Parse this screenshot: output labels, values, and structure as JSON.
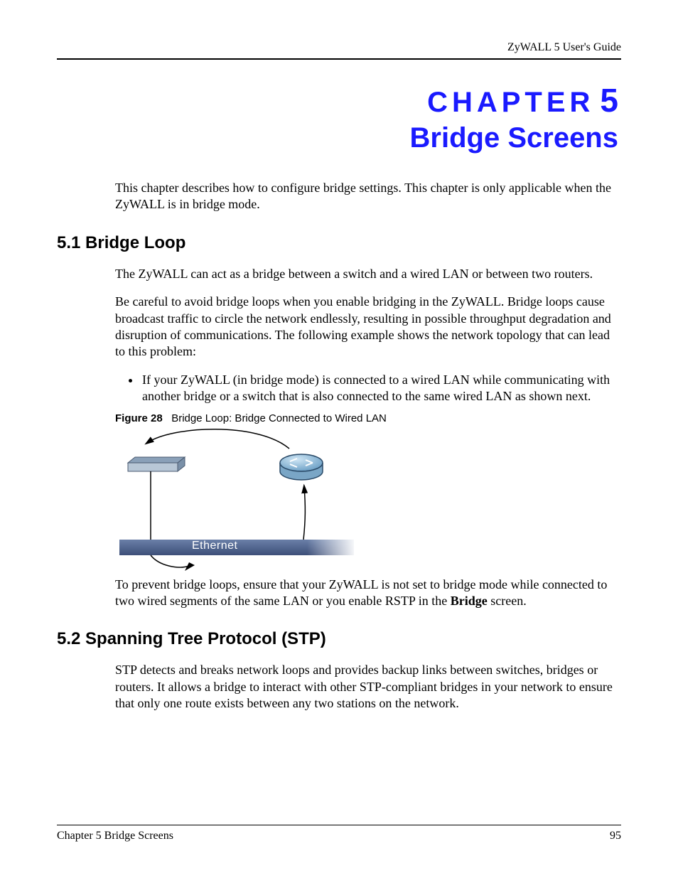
{
  "header": {
    "running_head": "ZyWALL 5 User's Guide"
  },
  "chapter": {
    "label_word": "CHAPTER",
    "number": "5",
    "title": "Bridge Screens",
    "intro": "This chapter describes how to configure bridge settings. This chapter is only applicable when the ZyWALL is in bridge mode."
  },
  "section51": {
    "heading": "5.1  Bridge Loop",
    "p1": "The ZyWALL can act as a bridge between a switch and a wired LAN or between two routers.",
    "p2": "Be careful to avoid bridge loops when you enable bridging in the ZyWALL. Bridge loops cause broadcast traffic to circle the network endlessly, resulting in possible throughput degradation and disruption of communications. The following example shows the network topology that can lead to this problem:",
    "bullet1": "If your ZyWALL (in bridge mode) is connected to a wired LAN while communicating with another bridge or a switch that is also connected to the same wired LAN as shown next.",
    "fig_label": "Figure 28",
    "fig_title": "Bridge Loop: Bridge Connected to Wired LAN",
    "ethernet_label": "Ethernet",
    "p3_a": "To prevent bridge loops, ensure that your ZyWALL is not set to bridge mode while connected to two wired segments of the same LAN or you enable RSTP in the ",
    "p3_bold": "Bridge",
    "p3_b": " screen."
  },
  "section52": {
    "heading": "5.2  Spanning Tree Protocol (STP)",
    "p1": "STP detects and breaks network loops and provides backup links between switches, bridges or routers. It allows a bridge to interact with other STP-compliant bridges in your network to ensure that only one route exists between any two stations on the network."
  },
  "footer": {
    "left": "Chapter 5 Bridge Screens",
    "right": "95"
  }
}
